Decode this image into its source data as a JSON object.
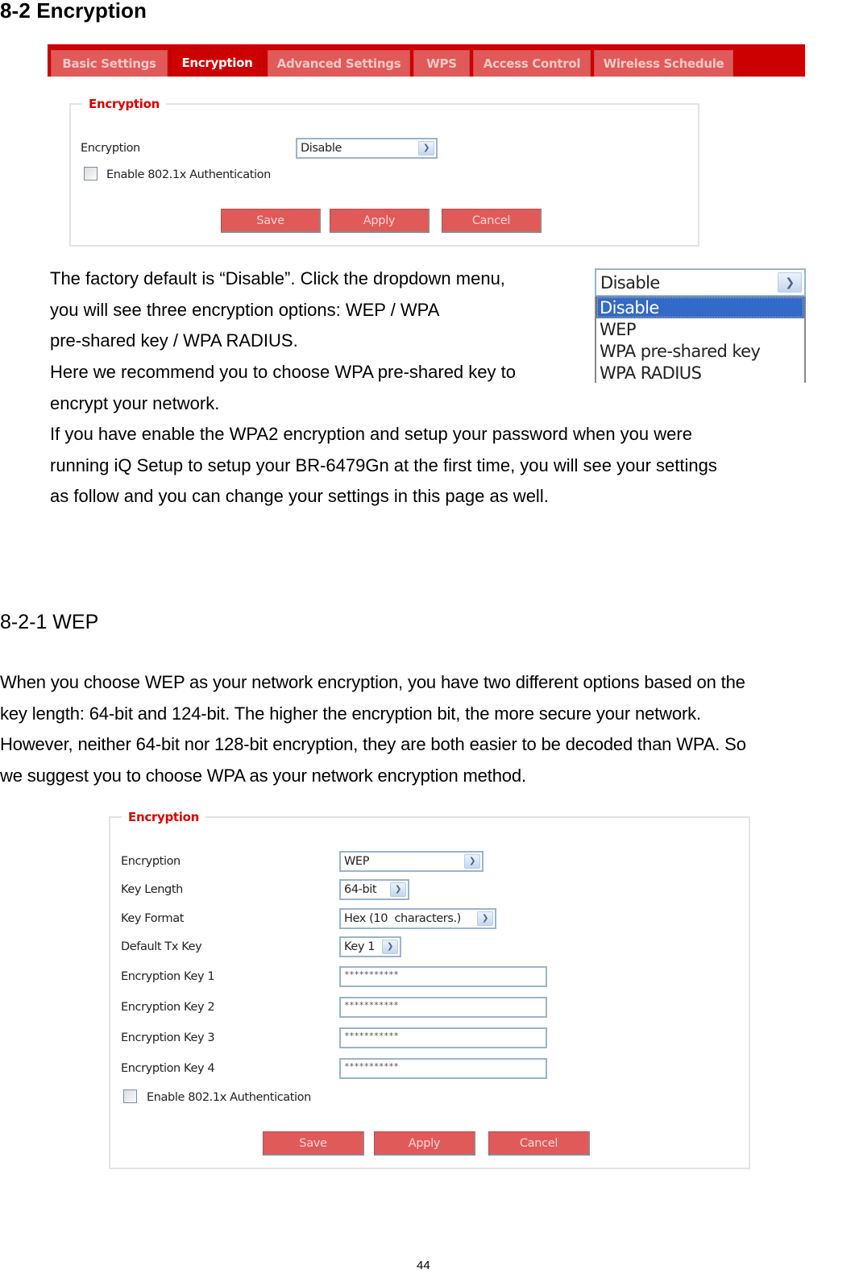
{
  "document": {
    "heading": "8-2 Encryption",
    "subheading": "8-2-1 WEP",
    "page_number": "44",
    "intro_paragraph_lines": [
      "The factory default is “Disable”. Click the dropdown menu,",
      "you will see three encryption options: WEP / WPA",
      "pre-shared key / WPA RADIUS.",
      "Here we recommend you to choose WPA pre-shared key to",
      "encrypt your network."
    ],
    "wpa2_paragraph_lines": [
      "If you have enable the WPA2 encryption and setup your password when you were",
      "running iQ Setup to setup your BR-6479Gn at the first time, you will see your settings",
      "as follow and you can change your settings in this page as well."
    ],
    "wep_paragraph_lines": [
      "When you choose WEP as your network encryption, you have two different options based on the",
      "key length: 64-bit and 124-bit. The higher the encryption bit, the more secure your network.",
      "However, neither 64-bit nor 128-bit encryption, they are both easier to be decoded than WPA. So",
      "we suggest you to choose WPA as your network encryption method."
    ]
  },
  "router_ui": {
    "colors": {
      "tabbar_bg": "#cc0000",
      "tab_bg": "#e05a5a",
      "legend_text": "#d40000",
      "button_bg": "#e05a5a",
      "dropdown_highlight": "#3369c8"
    },
    "tabs": [
      {
        "label": "Basic Settings",
        "active": false
      },
      {
        "label": "Encryption",
        "active": true
      },
      {
        "label": "Advanced Settings",
        "active": false
      },
      {
        "label": "WPS",
        "active": false
      },
      {
        "label": "Access Control",
        "active": false
      },
      {
        "label": "Wireless Schedule",
        "active": false
      }
    ],
    "panel1": {
      "legend": "Encryption",
      "encryption_label": "Encryption",
      "encryption_value": "Disable",
      "dropdown_icon": "chevron-down-icon",
      "auth_checkbox_label": "Enable 802.1x Authentication",
      "auth_checked": false,
      "buttons": {
        "save": "Save",
        "apply": "Apply",
        "cancel": "Cancel"
      }
    },
    "dropdown_example": {
      "selected": "Disable",
      "options": [
        {
          "label": "Disable",
          "highlighted": true
        },
        {
          "label": "WEP",
          "highlighted": false
        },
        {
          "label": "WPA pre-shared key",
          "highlighted": false
        },
        {
          "label": "WPA RADIUS",
          "highlighted": false
        }
      ]
    },
    "panel2": {
      "legend": "Encryption",
      "fields": {
        "encryption": {
          "label": "Encryption",
          "value": "WEP"
        },
        "key_length": {
          "label": "Key Length",
          "value": "64-bit"
        },
        "key_format": {
          "label": "Key Format",
          "value": "Hex (10  characters.)"
        },
        "default_tx_key": {
          "label": "Default Tx Key",
          "value": "Key 1"
        }
      },
      "keys": [
        {
          "label": "Encryption Key 1",
          "value": "***********"
        },
        {
          "label": "Encryption Key 2",
          "value": "***********"
        },
        {
          "label": "Encryption Key 3",
          "value": "***********"
        },
        {
          "label": "Encryption Key 4",
          "value": "***********"
        }
      ],
      "auth_checkbox_label": "Enable 802.1x Authentication",
      "auth_checked": false,
      "buttons": {
        "save": "Save",
        "apply": "Apply",
        "cancel": "Cancel"
      }
    }
  }
}
